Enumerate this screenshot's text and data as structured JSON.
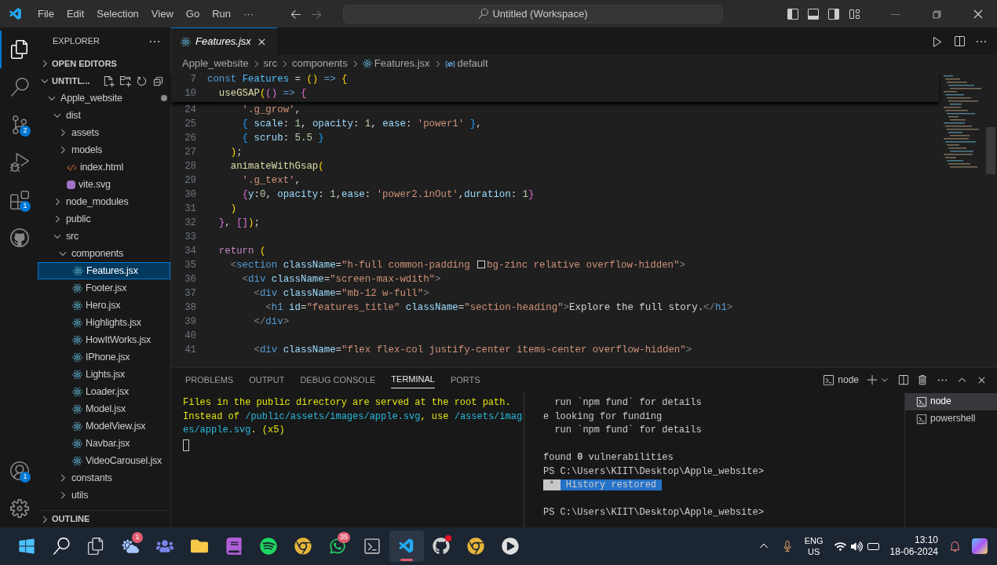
{
  "title_bar": {
    "menu": [
      "File",
      "Edit",
      "Selection",
      "View",
      "Go",
      "Run",
      "···"
    ],
    "search": "Untitled (Workspace)"
  },
  "activity_bar": [
    {
      "kind": "explorer",
      "selected": true
    },
    {
      "kind": "search",
      "selected": false
    },
    {
      "kind": "source-control",
      "selected": false,
      "badge": "2"
    },
    {
      "kind": "run",
      "selected": false
    },
    {
      "kind": "extensions",
      "selected": false,
      "badge": "1"
    },
    {
      "kind": "github",
      "selected": false
    },
    {
      "kind": "account",
      "selected": false,
      "badge": "1"
    },
    {
      "kind": "settings",
      "selected": false
    }
  ],
  "sidebar": {
    "title": "EXPLORER",
    "sections": [
      {
        "label": "OPEN EDITORS",
        "expanded": false
      },
      {
        "label": "UNTITL...",
        "expanded": true
      }
    ],
    "tree": [
      {
        "label": "Apple_website",
        "kind": "folder",
        "expanded": true,
        "modified": true,
        "selected": false,
        "children": [
          {
            "label": "dist",
            "kind": "folder",
            "expanded": true,
            "selected": false,
            "children": [
              {
                "label": "assets",
                "kind": "folder",
                "expanded": false,
                "selected": false
              },
              {
                "label": "models",
                "kind": "folder",
                "expanded": false,
                "selected": false
              },
              {
                "label": "index.html",
                "kind": "html",
                "selected": false
              },
              {
                "label": "vite.svg",
                "kind": "svg",
                "selected": false
              }
            ]
          },
          {
            "label": "node_modules",
            "kind": "folder",
            "expanded": false,
            "selected": false
          },
          {
            "label": "public",
            "kind": "folder",
            "expanded": false,
            "selected": false
          },
          {
            "label": "src",
            "kind": "folder",
            "expanded": true,
            "selected": false,
            "children": [
              {
                "label": "components",
                "kind": "folder",
                "expanded": true,
                "selected": false,
                "children": [
                  {
                    "label": "Features.jsx",
                    "kind": "react",
                    "selected": true
                  },
                  {
                    "label": "Footer.jsx",
                    "kind": "react",
                    "selected": false
                  },
                  {
                    "label": "Hero.jsx",
                    "kind": "react",
                    "selected": false
                  },
                  {
                    "label": "Highlights.jsx",
                    "kind": "react",
                    "selected": false
                  },
                  {
                    "label": "HowItWorks.jsx",
                    "kind": "react",
                    "selected": false
                  },
                  {
                    "label": "IPhone.jsx",
                    "kind": "react",
                    "selected": false
                  },
                  {
                    "label": "Lights.jsx",
                    "kind": "react",
                    "selected": false
                  },
                  {
                    "label": "Loader.jsx",
                    "kind": "react",
                    "selected": false
                  },
                  {
                    "label": "Model.jsx",
                    "kind": "react",
                    "selected": false
                  },
                  {
                    "label": "ModelView.jsx",
                    "kind": "react",
                    "selected": false
                  },
                  {
                    "label": "Navbar.jsx",
                    "kind": "react",
                    "selected": false
                  },
                  {
                    "label": "VideoCarousel.jsx",
                    "kind": "react",
                    "selected": false
                  }
                ]
              },
              {
                "label": "constants",
                "kind": "folder",
                "expanded": false,
                "selected": false
              },
              {
                "label": "utils",
                "kind": "folder",
                "expanded": false,
                "selected": false
              }
            ]
          }
        ]
      }
    ],
    "outline": "OUTLINE"
  },
  "tabs": [
    {
      "label": "Features.jsx",
      "selected": true
    }
  ],
  "breadcrumbs": [
    {
      "label": "Apple_website",
      "kind": "folder"
    },
    {
      "label": "src",
      "kind": "folder"
    },
    {
      "label": "components",
      "kind": "folder"
    },
    {
      "label": "Features.jsx",
      "kind": "react"
    },
    {
      "label": "default",
      "kind": "symbol"
    }
  ],
  "editor": {
    "sticky": [
      {
        "number": "7",
        "tokens": [
          {
            "kind": "kw",
            "text": "const "
          },
          {
            "kind": "const",
            "text": "Features"
          },
          {
            "kind": "punc",
            "text": " = "
          },
          {
            "kind": "br1",
            "text": "()"
          },
          {
            "kind": "kw",
            "text": " => "
          },
          {
            "kind": "br1",
            "text": "{"
          }
        ]
      },
      {
        "number": "10",
        "tokens": [
          {
            "kind": "fn",
            "text": "  useGSAP"
          },
          {
            "kind": "br1",
            "text": "("
          },
          {
            "kind": "br2",
            "text": "()"
          },
          {
            "kind": "kw",
            "text": " => "
          },
          {
            "kind": "br2",
            "text": "{"
          }
        ]
      }
    ],
    "lines": [
      {
        "number": "24",
        "tokens": [
          {
            "kind": "str",
            "text": "      '.g_grow'"
          },
          {
            "kind": "punc",
            "text": ","
          }
        ]
      },
      {
        "number": "25",
        "tokens": [
          {
            "kind": "br3",
            "text": "      { "
          },
          {
            "kind": "var",
            "text": "scale"
          },
          {
            "kind": "punc",
            "text": ": "
          },
          {
            "kind": "num",
            "text": "1"
          },
          {
            "kind": "punc",
            "text": ", "
          },
          {
            "kind": "var",
            "text": "opacity"
          },
          {
            "kind": "punc",
            "text": ": "
          },
          {
            "kind": "num",
            "text": "1"
          },
          {
            "kind": "punc",
            "text": ", "
          },
          {
            "kind": "var",
            "text": "ease"
          },
          {
            "kind": "punc",
            "text": ": "
          },
          {
            "kind": "str",
            "text": "'power1'"
          },
          {
            "kind": "br3",
            "text": " }"
          },
          {
            "kind": "punc",
            "text": ","
          }
        ]
      },
      {
        "number": "26",
        "tokens": [
          {
            "kind": "br3",
            "text": "      { "
          },
          {
            "kind": "var",
            "text": "scrub"
          },
          {
            "kind": "punc",
            "text": ": "
          },
          {
            "kind": "num",
            "text": "5.5"
          },
          {
            "kind": "br3",
            "text": " }"
          }
        ]
      },
      {
        "number": "27",
        "tokens": [
          {
            "kind": "br1",
            "text": "    )"
          },
          {
            "kind": "punc",
            "text": ";"
          }
        ]
      },
      {
        "number": "28",
        "tokens": [
          {
            "kind": "fn",
            "text": "    animateWithGsap"
          },
          {
            "kind": "br1",
            "text": "("
          }
        ]
      },
      {
        "number": "29",
        "tokens": [
          {
            "kind": "str",
            "text": "      '.g_text'"
          },
          {
            "kind": "punc",
            "text": ","
          }
        ]
      },
      {
        "number": "30",
        "tokens": [
          {
            "kind": "br2",
            "text": "      {"
          },
          {
            "kind": "var",
            "text": "y"
          },
          {
            "kind": "punc",
            "text": ":"
          },
          {
            "kind": "num",
            "text": "0"
          },
          {
            "kind": "punc",
            "text": ", "
          },
          {
            "kind": "var",
            "text": "opacity"
          },
          {
            "kind": "punc",
            "text": ": "
          },
          {
            "kind": "num",
            "text": "1"
          },
          {
            "kind": "punc",
            "text": ","
          },
          {
            "kind": "var",
            "text": "ease"
          },
          {
            "kind": "punc",
            "text": ": "
          },
          {
            "kind": "str",
            "text": "'power2.inOut'"
          },
          {
            "kind": "punc",
            "text": ","
          },
          {
            "kind": "var",
            "text": "duration"
          },
          {
            "kind": "punc",
            "text": ": "
          },
          {
            "kind": "num",
            "text": "1"
          },
          {
            "kind": "br2",
            "text": "}"
          }
        ]
      },
      {
        "number": "31",
        "tokens": [
          {
            "kind": "br1",
            "text": "    )"
          }
        ]
      },
      {
        "number": "32",
        "tokens": [
          {
            "kind": "br2",
            "text": "  }"
          },
          {
            "kind": "punc",
            "text": ", "
          },
          {
            "kind": "br2",
            "text": "[]"
          },
          {
            "kind": "br1",
            "text": ")"
          },
          {
            "kind": "punc",
            "text": ";"
          }
        ]
      },
      {
        "number": "33"
      },
      {
        "number": "34",
        "tokens": [
          {
            "kind": "ctrl",
            "text": "  return "
          },
          {
            "kind": "br1",
            "text": "("
          }
        ]
      },
      {
        "number": "35",
        "tokens": [
          {
            "kind": "tag",
            "text": "    <"
          },
          {
            "kind": "tagname",
            "text": "section"
          },
          {
            "kind": "attr",
            "text": " className"
          },
          {
            "kind": "punc",
            "text": "="
          },
          {
            "kind": "str",
            "text": "\"h-full common-padding "
          },
          {
            "kind": "swatch"
          },
          {
            "kind": "str",
            "text": "bg-zinc relative overflow-hidden\""
          },
          {
            "kind": "tag",
            "text": ">"
          }
        ]
      },
      {
        "number": "36",
        "tokens": [
          {
            "kind": "tag",
            "text": "      <"
          },
          {
            "kind": "tagname",
            "text": "div"
          },
          {
            "kind": "attr",
            "text": " className"
          },
          {
            "kind": "punc",
            "text": "="
          },
          {
            "kind": "str",
            "text": "\"screen-max-wdith\""
          },
          {
            "kind": "tag",
            "text": ">"
          }
        ]
      },
      {
        "number": "37",
        "tokens": [
          {
            "kind": "tag",
            "text": "        <"
          },
          {
            "kind": "tagname",
            "text": "div"
          },
          {
            "kind": "attr",
            "text": " className"
          },
          {
            "kind": "punc",
            "text": "="
          },
          {
            "kind": "str",
            "text": "\"mb-12 w-full\""
          },
          {
            "kind": "tag",
            "text": ">"
          }
        ]
      },
      {
        "number": "38",
        "tokens": [
          {
            "kind": "tag",
            "text": "          <"
          },
          {
            "kind": "tagname",
            "text": "h1"
          },
          {
            "kind": "attr",
            "text": " id"
          },
          {
            "kind": "punc",
            "text": "="
          },
          {
            "kind": "str",
            "text": "\"features_title\""
          },
          {
            "kind": "attr",
            "text": " className"
          },
          {
            "kind": "punc",
            "text": "="
          },
          {
            "kind": "str",
            "text": "\"section-heading\""
          },
          {
            "kind": "tag",
            "text": ">"
          },
          {
            "kind": "punc",
            "text": "Explore the full story."
          },
          {
            "kind": "tag",
            "text": "</"
          },
          {
            "kind": "tagname",
            "text": "h1"
          },
          {
            "kind": "tag",
            "text": ">"
          }
        ]
      },
      {
        "number": "39",
        "tokens": [
          {
            "kind": "tag",
            "text": "        </"
          },
          {
            "kind": "tagname",
            "text": "div"
          },
          {
            "kind": "tag",
            "text": ">"
          }
        ]
      },
      {
        "number": "40"
      },
      {
        "number": "41",
        "tokens": [
          {
            "kind": "tag",
            "text": "        <"
          },
          {
            "kind": "tagname",
            "text": "div"
          },
          {
            "kind": "attr",
            "text": " className"
          },
          {
            "kind": "punc",
            "text": "="
          },
          {
            "kind": "str",
            "text": "\"flex flex-col justify-center items-center overflow-hidden\""
          },
          {
            "kind": "tag",
            "text": ">"
          }
        ]
      }
    ]
  },
  "panel": {
    "tabs": [
      {
        "label": "PROBLEMS",
        "selected": false
      },
      {
        "label": "OUTPUT",
        "selected": false
      },
      {
        "label": "DEBUG CONSOLE",
        "selected": false
      },
      {
        "label": "TERMINAL",
        "selected": true
      },
      {
        "label": "PORTS",
        "selected": false
      }
    ],
    "terminal_name": "node",
    "left_lines": [
      [
        {
          "kind": "warn",
          "text": "Files in the public directory are served at the root path."
        }
      ],
      [
        {
          "kind": "warn",
          "text": "Instead of "
        },
        {
          "kind": "path",
          "text": "/public/assets/images/apple.svg"
        },
        {
          "kind": "warn",
          "text": ", use "
        },
        {
          "kind": "path",
          "text": "/assets/imag"
        }
      ],
      [
        {
          "kind": "path",
          "text": "es/apple.svg"
        },
        {
          "kind": "warn",
          "text": ". (x5)"
        }
      ]
    ],
    "right_lines": [
      {
        "gap_before": false,
        "segments": [
          {
            "kind": "plain",
            "text": "  run `npm fund` for details"
          }
        ]
      },
      {
        "gap_before": false,
        "segments": [
          {
            "kind": "plain",
            "text": "e looking for funding"
          }
        ]
      },
      {
        "gap_before": false,
        "segments": [
          {
            "kind": "plain",
            "text": "  run `npm fund` for details"
          }
        ]
      },
      {
        "gap_before": true,
        "segments": [
          {
            "kind": "plain",
            "text": "found "
          },
          {
            "kind": "bold",
            "text": "0"
          },
          {
            "kind": "plain",
            "text": " vulnerabilities"
          }
        ]
      },
      {
        "gap_before": false,
        "segments": [
          {
            "kind": "plain",
            "text": "PS C:\\Users\\KIIT\\Desktop\\Apple_website>"
          }
        ]
      },
      {
        "gap_before": false,
        "segments": [
          {
            "kind": "mark",
            "text": " * "
          },
          {
            "kind": "badge",
            "text": " History restored "
          }
        ]
      },
      {
        "gap_before": true,
        "segments": [
          {
            "kind": "plain",
            "text": "PS C:\\Users\\KIIT\\Desktop\\Apple_website>"
          }
        ]
      }
    ],
    "terminals": [
      {
        "label": "node",
        "selected": true
      },
      {
        "label": "powershell",
        "selected": false
      }
    ]
  },
  "taskbar": {
    "apps": [
      {
        "kind": "start",
        "alert": false,
        "active": false
      },
      {
        "kind": "search",
        "alert": false,
        "active": false
      },
      {
        "kind": "task-view",
        "alert": false,
        "active": false
      },
      {
        "kind": "weather",
        "badge": "1",
        "alert": false,
        "active": false
      },
      {
        "kind": "teams",
        "alert": false,
        "active": false
      },
      {
        "kind": "files",
        "alert": false,
        "active": false
      },
      {
        "kind": "onenote",
        "alert": false,
        "active": false
      },
      {
        "kind": "spotify",
        "alert": false,
        "active": false
      },
      {
        "kind": "chrome",
        "alert": false,
        "active": false
      },
      {
        "kind": "whatsapp",
        "badge": "35",
        "alert": false,
        "active": false
      },
      {
        "kind": "terminal",
        "alert": false,
        "active": false
      },
      {
        "kind": "vscode",
        "alert": false,
        "active": true
      },
      {
        "kind": "github-desktop",
        "alert": true,
        "active": false
      },
      {
        "kind": "chrome",
        "alert": false,
        "active": false
      },
      {
        "kind": "media",
        "alert": false,
        "active": false
      }
    ],
    "language": [
      "ENG",
      "US"
    ],
    "time": "13:10",
    "date": "18-06-2024"
  }
}
